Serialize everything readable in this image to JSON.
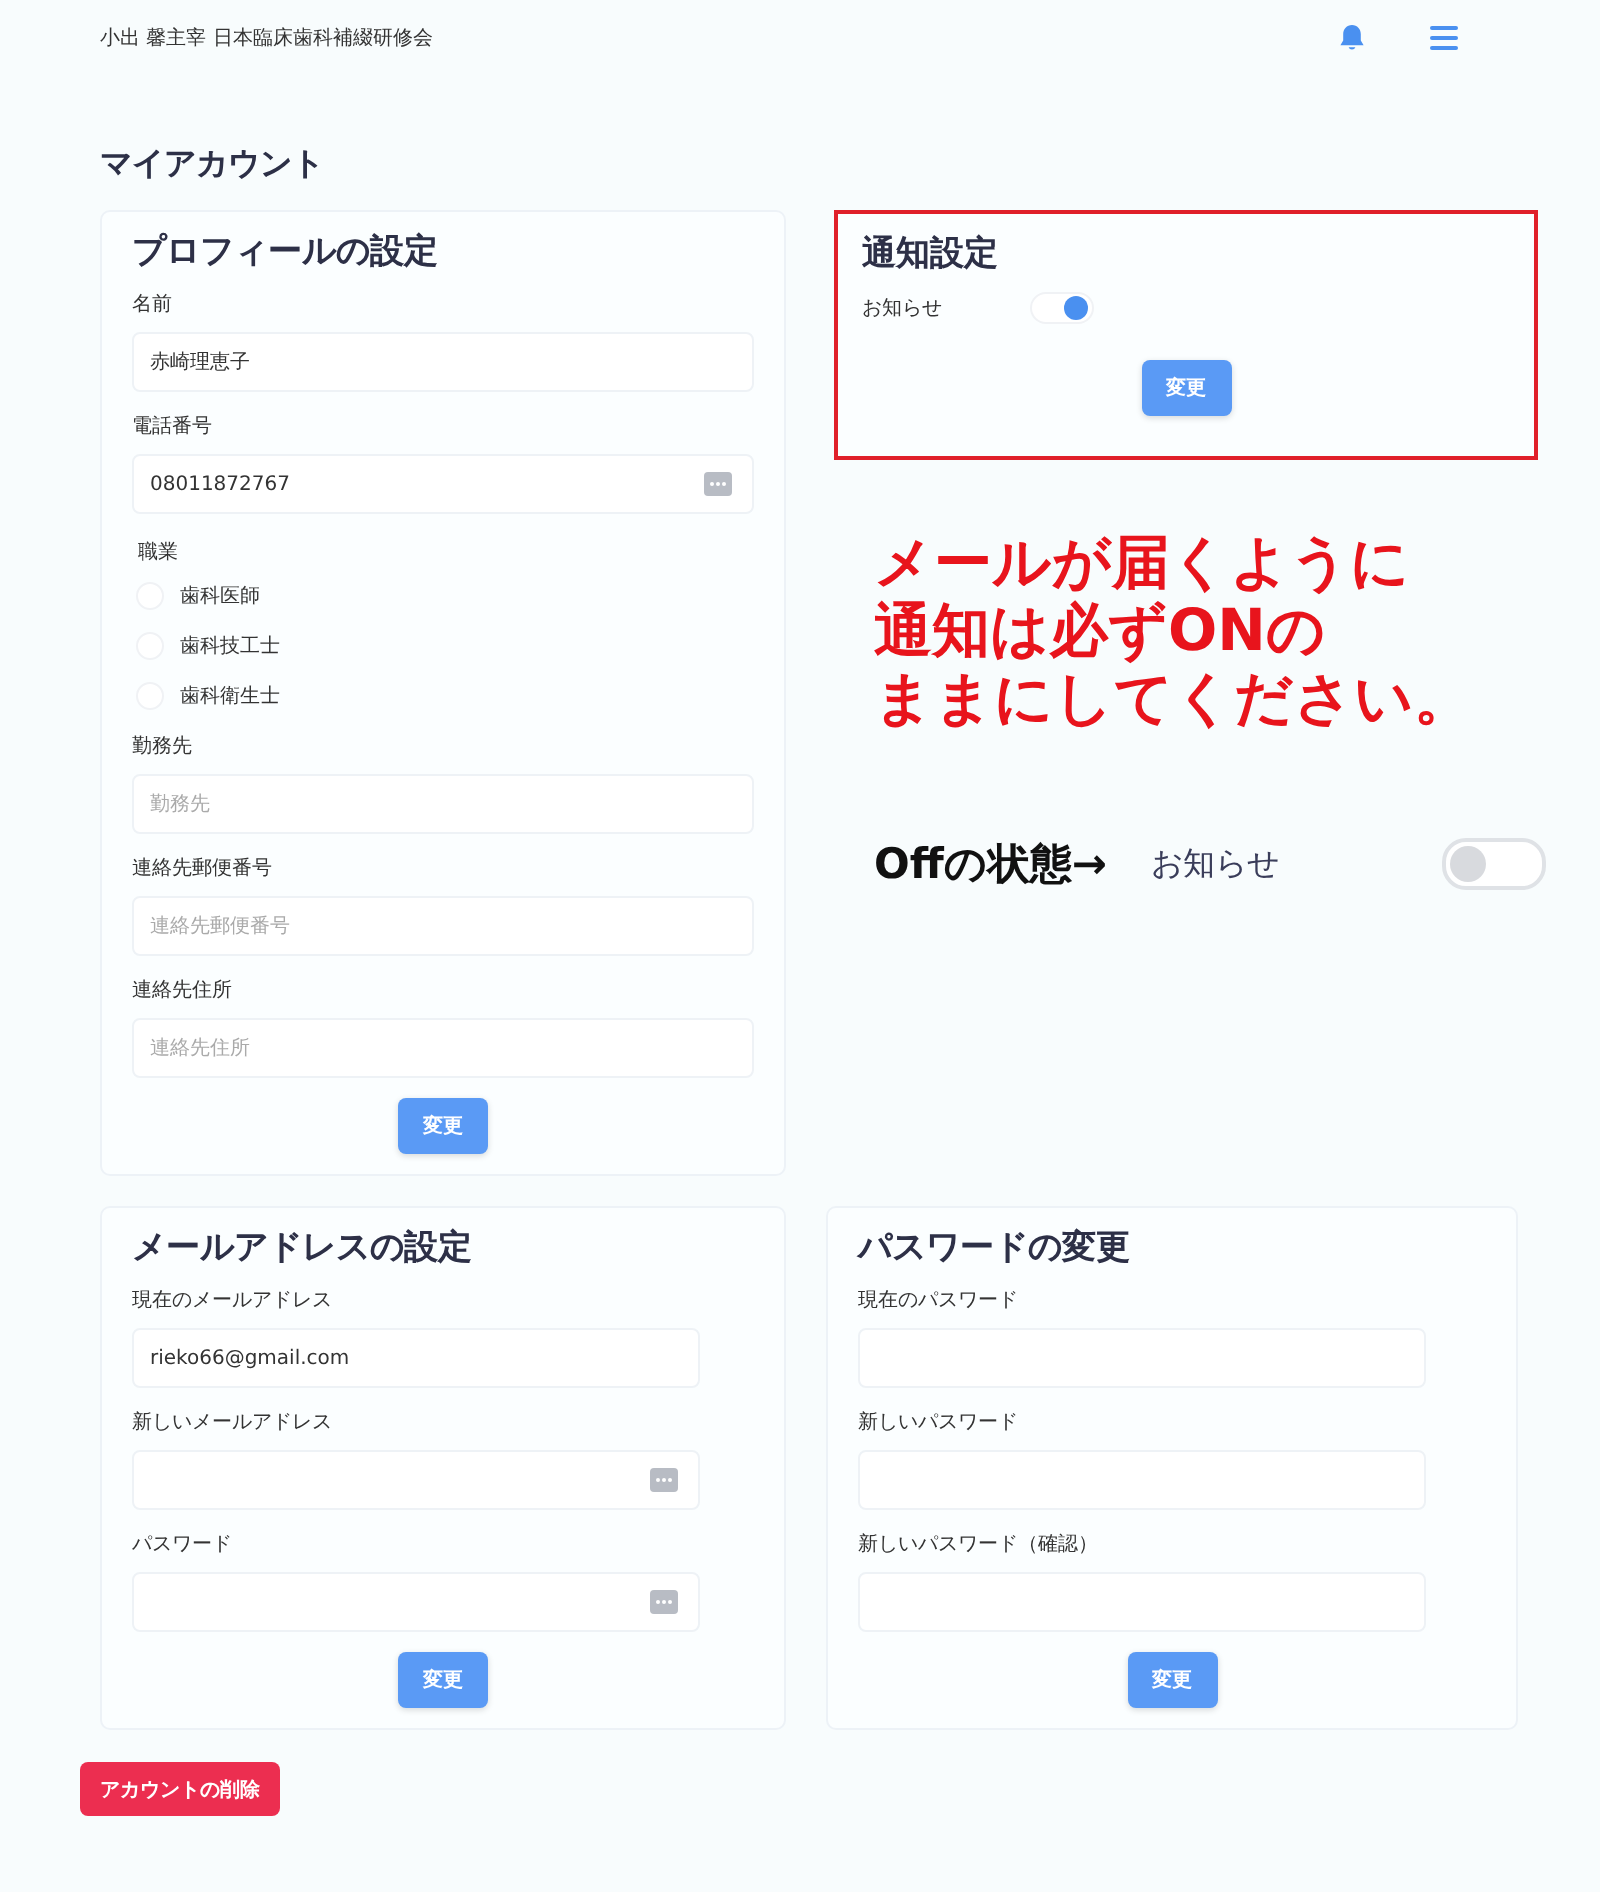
{
  "header": {
    "user": "小出 馨主宰 日本臨床歯科補綴研修会"
  },
  "page_title": "マイアカウント",
  "profile": {
    "title": "プロフィールの設定",
    "fields": [
      {
        "kind": "input",
        "label": "名前",
        "value": "赤崎理恵子",
        "autofill_icon": false
      },
      {
        "kind": "input",
        "label": "電話番号",
        "value": "08011872767",
        "autofill_icon": true
      },
      {
        "kind": "radio",
        "label": "職業",
        "options": [
          {
            "label": "歯科医師",
            "selected": false
          },
          {
            "label": "歯科技工士",
            "selected": false
          },
          {
            "label": "歯科衛生士",
            "selected": false
          }
        ]
      },
      {
        "kind": "input",
        "label": "勤務先",
        "placeholder": "勤務先",
        "autofill_icon": false
      },
      {
        "kind": "input",
        "label": "連絡先郵便番号",
        "placeholder": "連絡先郵便番号",
        "autofill_icon": false
      },
      {
        "kind": "input",
        "label": "連絡先住所",
        "placeholder": "連絡先住所",
        "autofill_icon": false
      }
    ],
    "button": "変更"
  },
  "notification": {
    "title": "通知設定",
    "setting": {
      "label": "お知らせ",
      "on": true
    },
    "button": "変更"
  },
  "annotation": {
    "lines": [
      "メールが届くように",
      "通知は必ずONの",
      "ままにしてください。"
    ],
    "example": {
      "caption": "Offの状態→",
      "label": "お知らせ",
      "on": false
    }
  },
  "email": {
    "title": "メールアドレスの設定",
    "fields": [
      {
        "kind": "input",
        "label": "現在のメールアドレス",
        "value": "rieko66@gmail.com",
        "autofill_icon": false
      },
      {
        "kind": "input",
        "label": "新しいメールアドレス",
        "autofill_icon": true
      },
      {
        "kind": "input",
        "label": "パスワード",
        "autofill_icon": true
      }
    ],
    "button": "変更"
  },
  "password": {
    "title": "パスワードの変更",
    "fields": [
      {
        "kind": "input",
        "label": "現在のパスワード",
        "autofill_icon": false
      },
      {
        "kind": "input",
        "label": "新しいパスワード",
        "autofill_icon": false
      },
      {
        "kind": "input",
        "label": "新しいパスワード（確認）",
        "autofill_icon": false
      }
    ],
    "button": "変更"
  },
  "delete_button": "アカウントの削除"
}
